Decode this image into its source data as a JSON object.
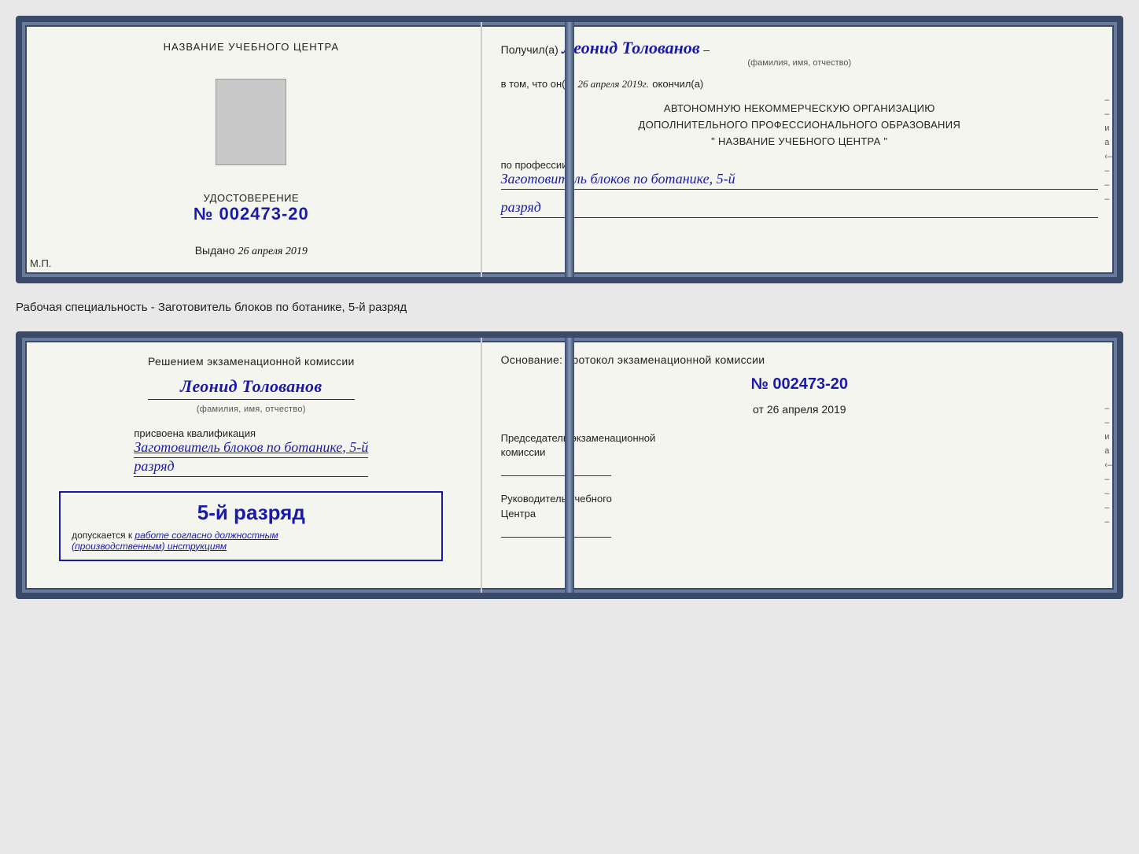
{
  "top_cert": {
    "left": {
      "title": "НАЗВАНИЕ УЧЕБНОГО ЦЕНТРА",
      "cert_label": "УДОСТОВЕРЕНИЕ",
      "cert_number_prefix": "№",
      "cert_number": "002473-20",
      "issued_label": "Выдано",
      "issued_date": "26 апреля 2019",
      "mp_label": "М.П."
    },
    "right": {
      "received_prefix": "Получил(а)",
      "recipient_name": "Леонид Толованов",
      "fio_label": "(фамилия, имя, отчество)",
      "completed_prefix": "в том, что он(а)",
      "completed_date": "26 апреля 2019г.",
      "completed_suffix": "окончил(а)",
      "org_line1": "АВТОНОМНУЮ НЕКОММЕРЧЕСКУЮ ОРГАНИЗАЦИЮ",
      "org_line2": "ДОПОЛНИТЕЛЬНОГО ПРОФЕССИОНАЛЬНОГО ОБРАЗОВАНИЯ",
      "org_line3": "\"   НАЗВАНИЕ УЧЕБНОГО ЦЕНТРА   \"",
      "profession_label": "по профессии",
      "profession_name": "Заготовитель блоков по ботанике, 5-й",
      "rank": "разряд"
    }
  },
  "middle_label": "Рабочая специальность - Заготовитель блоков по ботанике, 5-й разряд",
  "bottom_cert": {
    "left": {
      "decision_text": "Решением экзаменационной комиссии",
      "person_name": "Леонид Толованов",
      "fio_label": "(фамилия, имя, отчество)",
      "qualified_label": "присвоена квалификация",
      "qualification": "Заготовитель блоков по ботанике, 5-й",
      "rank": "разряд",
      "stamp_rank": "5-й разряд",
      "stamp_prefix": "допускается к",
      "stamp_italic": "работе согласно должностным",
      "stamp_italic2": "(производственным) инструкциям"
    },
    "right": {
      "basis_label": "Основание: протокол экзаменационной комиссии",
      "protocol_number_prefix": "№",
      "protocol_number": "002473-20",
      "date_prefix": "от",
      "protocol_date": "26 апреля 2019",
      "chair_role_line1": "Председатель экзаменационной",
      "chair_role_line2": "комиссии",
      "head_role_line1": "Руководитель учебного",
      "head_role_line2": "Центра"
    }
  },
  "side_marks": {
    "labels": [
      "–",
      "–",
      "и",
      "а",
      "‹–",
      "–",
      "–",
      "–",
      "–"
    ]
  }
}
